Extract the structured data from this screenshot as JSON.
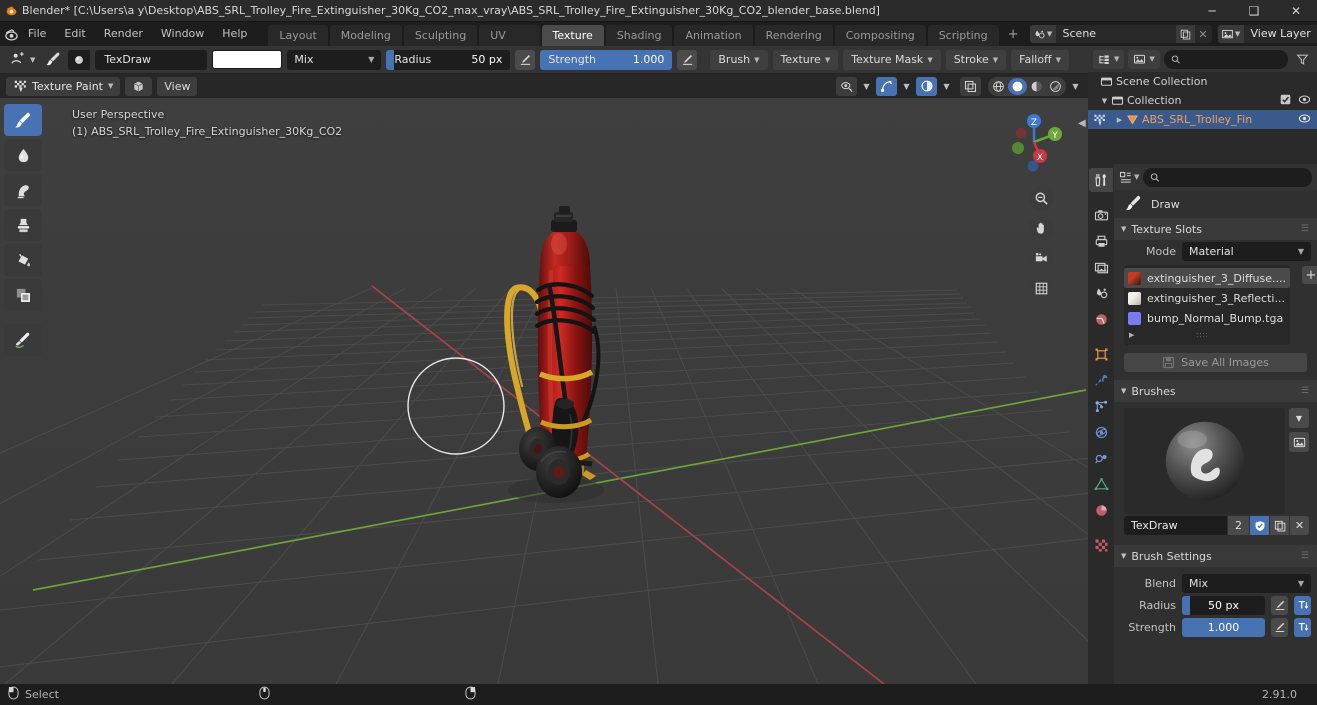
{
  "window": {
    "title": "Blender* [C:\\Users\\a y\\Desktop\\ABS_SRL_Trolley_Fire_Extinguisher_30Kg_CO2_max_vray\\ABS_SRL_Trolley_Fire_Extinguisher_30Kg_CO2_blender_base.blend]",
    "minimize": "─",
    "maximize": "❑",
    "close": "✕"
  },
  "menubar": {
    "items": [
      "File",
      "Edit",
      "Render",
      "Window",
      "Help"
    ],
    "workspaces": [
      {
        "label": "Layout",
        "active": false
      },
      {
        "label": "Modeling",
        "active": false
      },
      {
        "label": "Sculpting",
        "active": false
      },
      {
        "label": "UV Editing",
        "active": false
      },
      {
        "label": "Texture Paint",
        "active": true
      },
      {
        "label": "Shading",
        "active": false
      },
      {
        "label": "Animation",
        "active": false
      },
      {
        "label": "Rendering",
        "active": false
      },
      {
        "label": "Compositing",
        "active": false
      },
      {
        "label": "Scripting",
        "active": false
      }
    ],
    "add_workspace": "+",
    "scene_name": "Scene",
    "view_layer_name": "View Layer"
  },
  "tool_settings": {
    "brush_name": "TexDraw",
    "color": "#ffffff",
    "blend_mode": "Mix",
    "radius_label": "Radius",
    "radius_value": "50 px",
    "radius_fill_pct": 6,
    "strength_label": "Strength",
    "strength_value": "1.000",
    "strength_fill_pct": 100,
    "dropdowns": [
      "Brush",
      "Texture",
      "Texture Mask",
      "Stroke",
      "Falloff"
    ]
  },
  "viewport_header": {
    "mode": "Texture Paint",
    "view_menu": "View"
  },
  "viewport": {
    "perspective": "User Perspective",
    "object_info": "(1) ABS_SRL_Trolley_Fire_Extinguisher_30Kg_CO2",
    "gizmo_axes": {
      "x": "X",
      "y": "Y",
      "z": "Z"
    },
    "background": "#3d3d3d"
  },
  "toolbar": {
    "tools": [
      {
        "name": "draw-tool",
        "active": true
      },
      {
        "name": "soften-tool",
        "active": false
      },
      {
        "name": "smear-tool",
        "active": false
      },
      {
        "name": "clone-tool",
        "active": false
      },
      {
        "name": "fill-tool",
        "active": false
      },
      {
        "name": "mask-tool",
        "active": false
      },
      {
        "name": "annotate-tool",
        "active": false
      }
    ]
  },
  "outliner": {
    "search_placeholder": "",
    "rows": [
      {
        "label": "Scene Collection",
        "indent": 10,
        "has_tri": false,
        "selected": false,
        "checkbox": false,
        "eye": false
      },
      {
        "label": "Collection",
        "indent": 22,
        "has_tri": true,
        "selected": false,
        "checkbox": true,
        "eye": true
      },
      {
        "label": "ABS_SRL_Trolley_Fin",
        "indent": 38,
        "has_tri": true,
        "selected": true,
        "checkbox": false,
        "eye": true
      }
    ]
  },
  "properties": {
    "search_placeholder": "",
    "context_item": "Draw",
    "texture_slots": {
      "title": "Texture Slots",
      "mode_label": "Mode",
      "mode_value": "Material",
      "add_label": "+",
      "slots": [
        {
          "name": "extinguisher_3_Diffuse....",
          "color": "#b4432a",
          "selected": true
        },
        {
          "name": "extinguisher_3_Reflecti...",
          "color": "#e8e4de",
          "selected": false
        },
        {
          "name": "bump_Normal_Bump.tga",
          "color": "#7b7bf0",
          "selected": false
        }
      ],
      "save_all_label": "Save All Images"
    },
    "brushes": {
      "title": "Brushes",
      "brush_name": "TexDraw",
      "user_count": "2",
      "fake_user_icon": "shield-icon",
      "duplicate_icon": "copy-icon",
      "unlink_icon": "x-icon"
    },
    "brush_settings": {
      "title": "Brush Settings",
      "blend_label": "Blend",
      "blend_value": "Mix",
      "radius_label": "Radius",
      "radius_value": "50 px",
      "radius_fill_pct": 10,
      "strength_label": "Strength",
      "strength_value": "1.000",
      "strength_fill_pct": 100
    },
    "tabs": [
      {
        "name": "tool-tab",
        "active": true
      },
      {
        "name": "render-tab",
        "active": false
      },
      {
        "name": "output-tab",
        "active": false
      },
      {
        "name": "view-layer-tab",
        "active": false
      },
      {
        "name": "scene-tab",
        "active": false
      },
      {
        "name": "world-tab",
        "active": false
      },
      {
        "name": "object-tab",
        "active": false
      },
      {
        "name": "modifier-tab",
        "active": false
      },
      {
        "name": "particles-tab",
        "active": false
      },
      {
        "name": "physics-tab",
        "active": false
      },
      {
        "name": "constraints-tab",
        "active": false
      },
      {
        "name": "data-tab",
        "active": false
      },
      {
        "name": "material-tab",
        "active": false
      },
      {
        "name": "texture-tab",
        "active": false
      }
    ]
  },
  "statusbar": {
    "select_label": "Select",
    "version": "2.91.0"
  }
}
